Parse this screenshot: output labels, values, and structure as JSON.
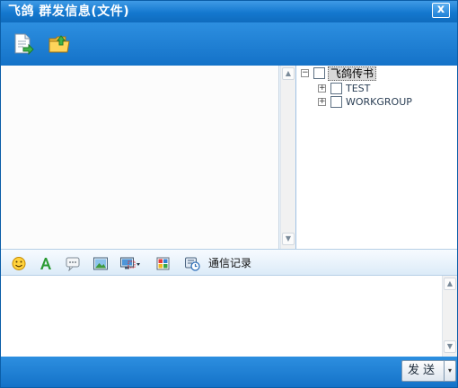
{
  "window": {
    "title": "飞鸽 群发信息(文件)",
    "close_glyph": "x"
  },
  "toolbar": {
    "items": [
      {
        "icon": "send-file-icon"
      },
      {
        "icon": "send-folder-icon"
      }
    ]
  },
  "tree": {
    "root": {
      "label": "飞鸽传书",
      "expander": "−"
    },
    "groups": [
      {
        "label": "TEST",
        "expander": "+"
      },
      {
        "label": "WORKGROUP",
        "expander": "+"
      }
    ]
  },
  "format_bar": {
    "icons": [
      "emoji-icon",
      "font-icon",
      "shake-icon",
      "image-icon",
      "screenshot-icon",
      "color-icon",
      "history-icon"
    ],
    "history_label": "通信记录"
  },
  "scroll": {
    "up": "▲",
    "down": "▼"
  },
  "send": {
    "label": "发送",
    "dropdown_glyph": "▾"
  },
  "colors": {
    "titlebar": "#1478cf",
    "accent": "#2d8fe0",
    "panel": "#e9f2fb"
  }
}
